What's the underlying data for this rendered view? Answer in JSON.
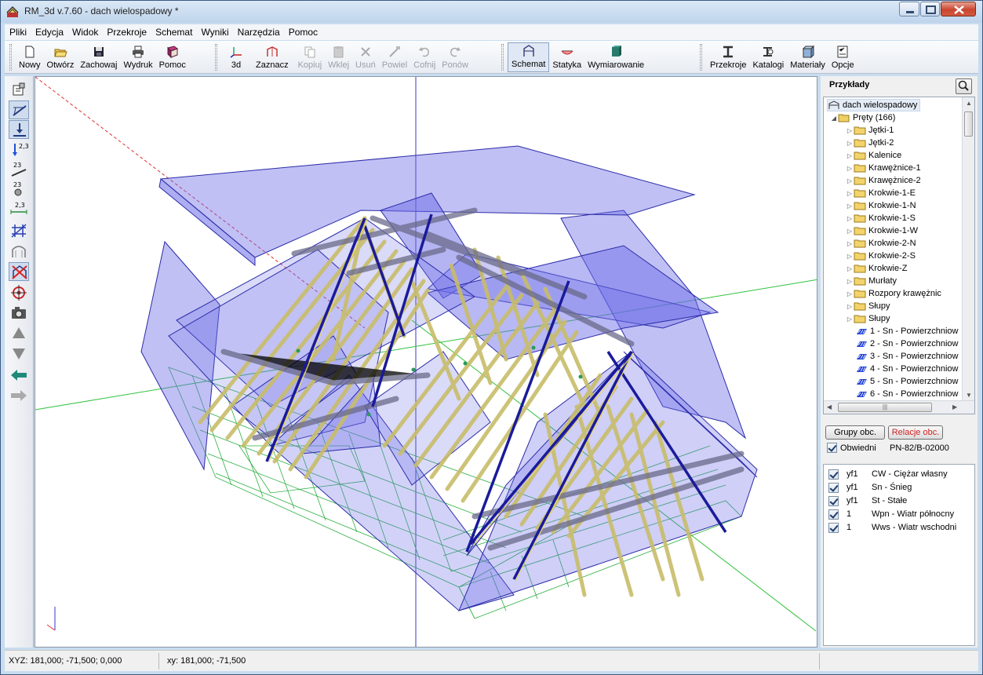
{
  "window": {
    "title": "RM_3d v.7.60 - dach wielospadowy *"
  },
  "menu": [
    "Pliki",
    "Edycja",
    "Widok",
    "Przekroje",
    "Schemat",
    "Wyniki",
    "Narzędzia",
    "Pomoc"
  ],
  "toolbar": {
    "file": [
      {
        "label": "Nowy",
        "icon": "new-doc-icon",
        "enabled": true
      },
      {
        "label": "Otwórz",
        "icon": "open-folder-icon",
        "enabled": true
      },
      {
        "label": "Zachowaj",
        "icon": "save-disk-icon",
        "enabled": true
      },
      {
        "label": "Wydruk",
        "icon": "printer-icon",
        "enabled": true
      },
      {
        "label": "Pomoc",
        "icon": "help-book-icon",
        "enabled": true
      }
    ],
    "edit": [
      {
        "label": "3d",
        "icon": "axes-3d-icon",
        "enabled": true
      },
      {
        "label": "Zaznacz",
        "icon": "select-icon",
        "enabled": true
      },
      {
        "label": "Kopiuj",
        "icon": "copy-icon",
        "enabled": false
      },
      {
        "label": "Wklej",
        "icon": "paste-icon",
        "enabled": false
      },
      {
        "label": "Usuń",
        "icon": "delete-icon",
        "enabled": false
      },
      {
        "label": "Powiel",
        "icon": "duplicate-icon",
        "enabled": false
      },
      {
        "label": "Cofnij",
        "icon": "undo-icon",
        "enabled": false
      },
      {
        "label": "Ponów",
        "icon": "redo-icon",
        "enabled": false
      }
    ],
    "mode": [
      {
        "label": "Schemat",
        "icon": "schema-icon",
        "enabled": true,
        "active": true
      },
      {
        "label": "Statyka",
        "icon": "statics-icon",
        "enabled": true
      },
      {
        "label": "Wymiarowanie",
        "icon": "dimensioning-icon",
        "enabled": true
      }
    ],
    "data": [
      {
        "label": "Przekroje",
        "icon": "section-icon",
        "enabled": true
      },
      {
        "label": "Katalogi",
        "icon": "catalog-icon",
        "enabled": true
      },
      {
        "label": "Materiały",
        "icon": "materials-icon",
        "enabled": true
      },
      {
        "label": "Opcje",
        "icon": "options-icon",
        "enabled": true
      }
    ]
  },
  "side_tools": [
    "properties-icon",
    "bar-tool-icon",
    "support-icon",
    "load-2-3-icon",
    "load-23-line-icon",
    "load-23-point-icon",
    "dimension-2-3-icon",
    "grid-frame-icon",
    "arc-frame-icon",
    "delete-frame-icon",
    "target-icon",
    "camera-icon",
    "arrow-up-icon",
    "arrow-down-icon",
    "arrow-left-icon",
    "arrow-right-icon"
  ],
  "panel": {
    "title": "Przykłady",
    "tree": {
      "root": "dach wielospadowy",
      "group": "Pręty (166)",
      "folders": [
        "Jętki-1",
        "Jętki-2",
        "Kalenice",
        "Krawężnice-1",
        "Krawężnice-2",
        "Krokwie-1-E",
        "Krokwie-1-N",
        "Krokwie-1-S",
        "Krokwie-1-W",
        "Krokwie-2-N",
        "Krokwie-2-S",
        "Krokwie-Z",
        "Murłaty",
        "Rozpory krawężnic",
        "Słupy",
        "Słupy"
      ],
      "surfaces": [
        "1 - Sn - Powierzchniow",
        "2 - Sn - Powierzchniow",
        "3 - Sn - Powierzchniow",
        "4 - Sn - Powierzchniow",
        "5 - Sn - Powierzchniow",
        "6 - Sn - Powierzchniow"
      ]
    },
    "buttons": {
      "groups": "Grupy obc.",
      "relations": "Relacje obc."
    },
    "envelopes_label": "Obwiedni",
    "norm": "PN-82/B-02000",
    "loads": [
      {
        "factor": "yf1",
        "name": "CW - Ciężar własny"
      },
      {
        "factor": "yf1",
        "name": "Sn - Śnieg"
      },
      {
        "factor": "yf1",
        "name": "St - Stałe"
      },
      {
        "factor": "1",
        "name": "Wpn - Wiatr północny"
      },
      {
        "factor": "1",
        "name": "Wws - Wiatr wschodni"
      }
    ]
  },
  "status": {
    "xyz": "XYZ: 181,000; -71,500; 0,000",
    "xy": "xy: 181,000; -71,500"
  }
}
